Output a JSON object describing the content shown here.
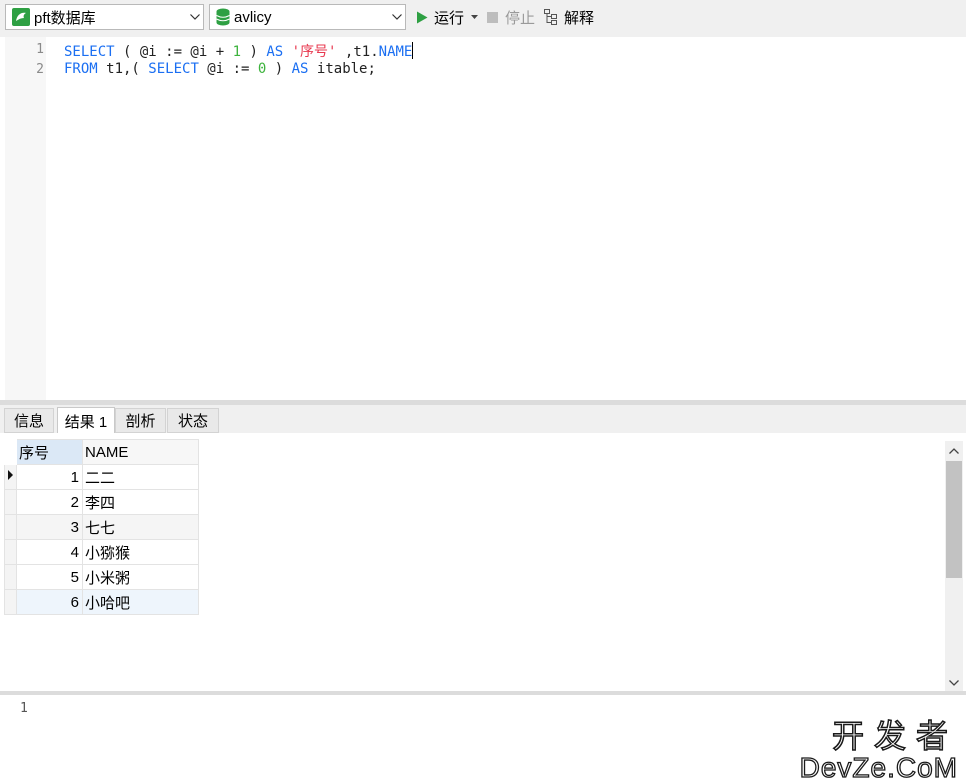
{
  "toolbar": {
    "connection": "pft数据库",
    "database": "avlicy",
    "run": "运行",
    "stop": "停止",
    "explain": "解释",
    "accent_run": "#2ea043",
    "accent_db": "#2ea043"
  },
  "editor": {
    "lines": [
      {
        "num": "1"
      },
      {
        "num": "2"
      }
    ],
    "tokens1": [
      "SELECT",
      " ( @i := @i + ",
      "1",
      " ) ",
      "AS",
      " ",
      "'序号'",
      " ,t1.",
      "NAME"
    ],
    "tokens2": [
      "FROM",
      " t1,( ",
      "SELECT",
      " @i := ",
      "0",
      " ) ",
      "AS",
      " itable;"
    ]
  },
  "tabs": [
    "信息",
    "结果 1",
    "剖析",
    "状态"
  ],
  "results": {
    "columns": [
      "序号",
      "NAME"
    ],
    "rows": [
      {
        "seq": "1",
        "name": "二二"
      },
      {
        "seq": "2",
        "name": "李四"
      },
      {
        "seq": "3",
        "name": "七七"
      },
      {
        "seq": "4",
        "name": "小猕猴"
      },
      {
        "seq": "5",
        "name": "小米粥"
      },
      {
        "seq": "6",
        "name": "小哈吧"
      }
    ]
  },
  "message": {
    "line": "1"
  },
  "watermark": {
    "line1": "开发者",
    "line2": "DevZe.CoM"
  }
}
